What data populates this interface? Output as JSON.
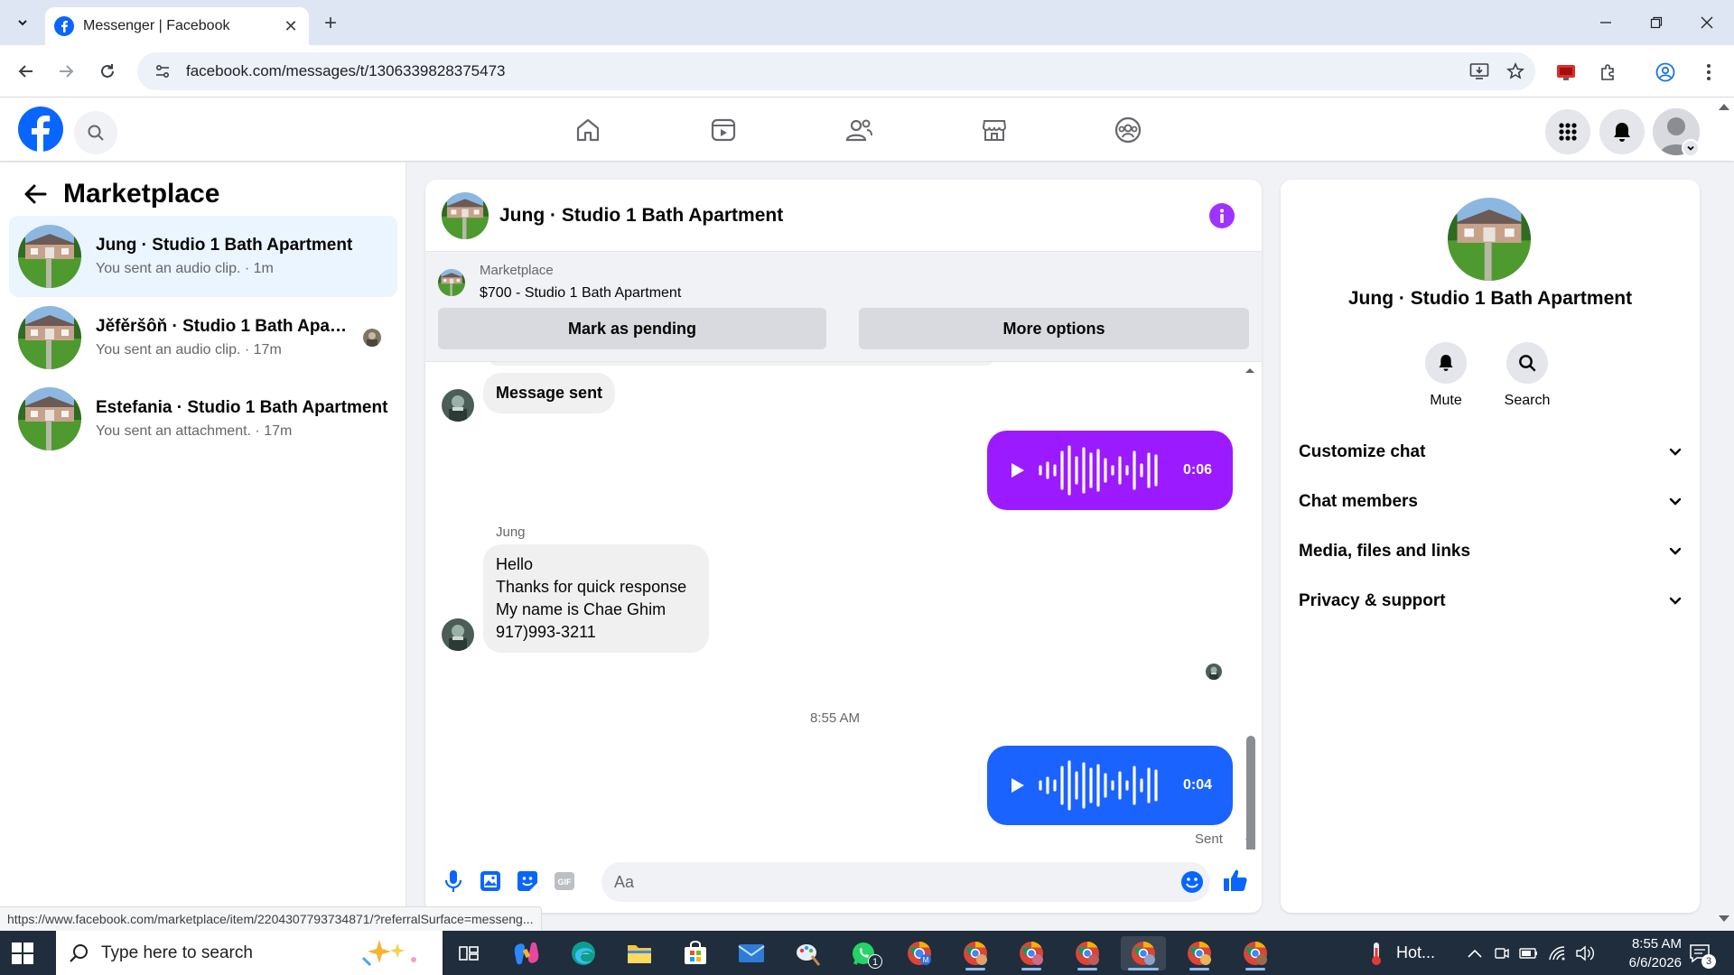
{
  "browser": {
    "tab_title": "Messenger | Facebook",
    "url": "facebook.com/messages/t/1306339828375473"
  },
  "left_panel": {
    "title": "Marketplace",
    "conversations": [
      {
        "name": "Jung · Studio 1 Bath Apartment",
        "snippet": "You sent an audio clip. · 1m"
      },
      {
        "name": "Jěfěršôň · Studio 1 Bath Apartm...",
        "snippet": "You sent an audio clip. · 17m"
      },
      {
        "name": "Estefania · Studio 1 Bath Apartment",
        "snippet": "You sent an attachment. · 17m"
      }
    ]
  },
  "conversation": {
    "title": "Jung · Studio 1 Bath Apartment",
    "marketplace_label": "Marketplace",
    "listing": "$700 - Studio 1 Bath Apartment",
    "mark_pending": "Mark as pending",
    "more_options": "More options",
    "messages": {
      "message_sent": "Message sent",
      "audio1_duration": "0:06",
      "sender_name": "Jung",
      "incoming_lines": [
        "Hello",
        "Thanks for quick response",
        "My name is Chae Ghim",
        "917)993-3211"
      ],
      "time": "8:55 AM",
      "audio2_duration": "0:04",
      "status": "Sent"
    },
    "composer_placeholder": "Aa"
  },
  "right_panel": {
    "name": "Jung · Studio 1 Bath Apartment",
    "mute_label": "Mute",
    "search_label": "Search",
    "sections": [
      "Customize chat",
      "Chat members",
      "Media, files and links",
      "Privacy & support"
    ]
  },
  "status_url": "https://www.facebook.com/marketplace/item/2204307793734871/?referralSurface=messeng...",
  "taskbar": {
    "search_placeholder": "Type here to search",
    "weather": "Hot...",
    "time": "8:55 AM",
    "date": "6/6/2026",
    "notification_count": "3",
    "whatsapp_badge": "1"
  },
  "colors": {
    "fb_blue": "#0866ff",
    "purple_bubble": "#9b1aff",
    "blue_bubble": "#1a63ff",
    "info_purple": "#a033ff",
    "active_conv_bg": "#ebf5ff"
  }
}
